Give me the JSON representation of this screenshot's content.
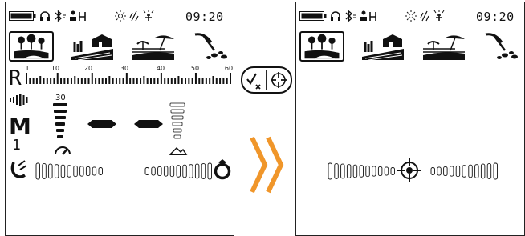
{
  "left_screen": {
    "status": {
      "time": "09:20",
      "battery_icon": "battery-full-icon",
      "headphones_icon": "headphones-icon",
      "bluetooth_icon": "bluetooth-icon",
      "wireless_icon": "wireless-icon",
      "backlight_icon": "backlight-icon",
      "vibration_icon": "vibration-icon",
      "flashlight_icon": "flashlight-icon"
    },
    "modes": [
      "park-mode",
      "field-mode",
      "beach-mode",
      "gold-mode"
    ],
    "selected_mode": 0,
    "scale": {
      "label": "R",
      "ticks": [
        "1",
        "10",
        "20",
        "30",
        "40",
        "50",
        "60"
      ]
    },
    "depth": {
      "value": "30"
    },
    "mode_letter": "M",
    "frequency_digit": "1",
    "target_id_display": "– –"
  },
  "right_screen": {
    "status": {
      "time": "09:20",
      "battery_icon": "battery-full-icon",
      "headphones_icon": "headphones-icon",
      "bluetooth_icon": "bluetooth-icon",
      "wireless_icon": "wireless-icon",
      "backlight_icon": "backlight-icon",
      "vibration_icon": "vibration-icon",
      "flashlight_icon": "flashlight-icon"
    },
    "modes": [
      "park-mode",
      "field-mode",
      "beach-mode",
      "gold-mode"
    ],
    "selected_mode": 0,
    "pinpoint_icon": "crosshair-icon"
  },
  "middle": {
    "button_icon": "pinpoint-button-icon",
    "arrow_icon": "double-chevron-right-icon"
  },
  "colors": {
    "arrow": "#f0962a",
    "ink": "#111111"
  }
}
